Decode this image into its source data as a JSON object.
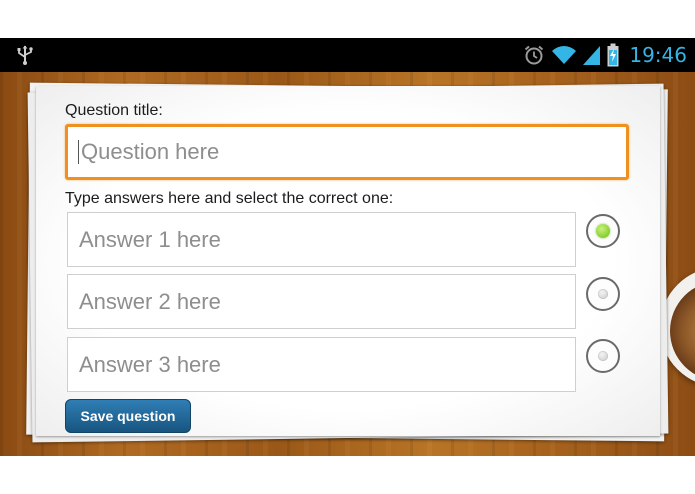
{
  "status_bar": {
    "time": "19:46",
    "icons": [
      "usb-icon",
      "alarm-icon",
      "wifi-icon",
      "signal-icon",
      "battery-charging-icon"
    ],
    "clock_color": "#33b5e5"
  },
  "form": {
    "question_label": "Question title:",
    "question_placeholder": "Question here",
    "answers_label": "Type answers here and select the correct one:",
    "answers": [
      {
        "placeholder": "Answer 1 here",
        "selected": true
      },
      {
        "placeholder": "Answer 2 here",
        "selected": false
      },
      {
        "placeholder": "Answer 3 here",
        "selected": false
      }
    ],
    "save_label": "Save question",
    "accent_color": "#f0901e",
    "button_color": "#1f6a9c",
    "selected_color": "#6cbf12"
  }
}
